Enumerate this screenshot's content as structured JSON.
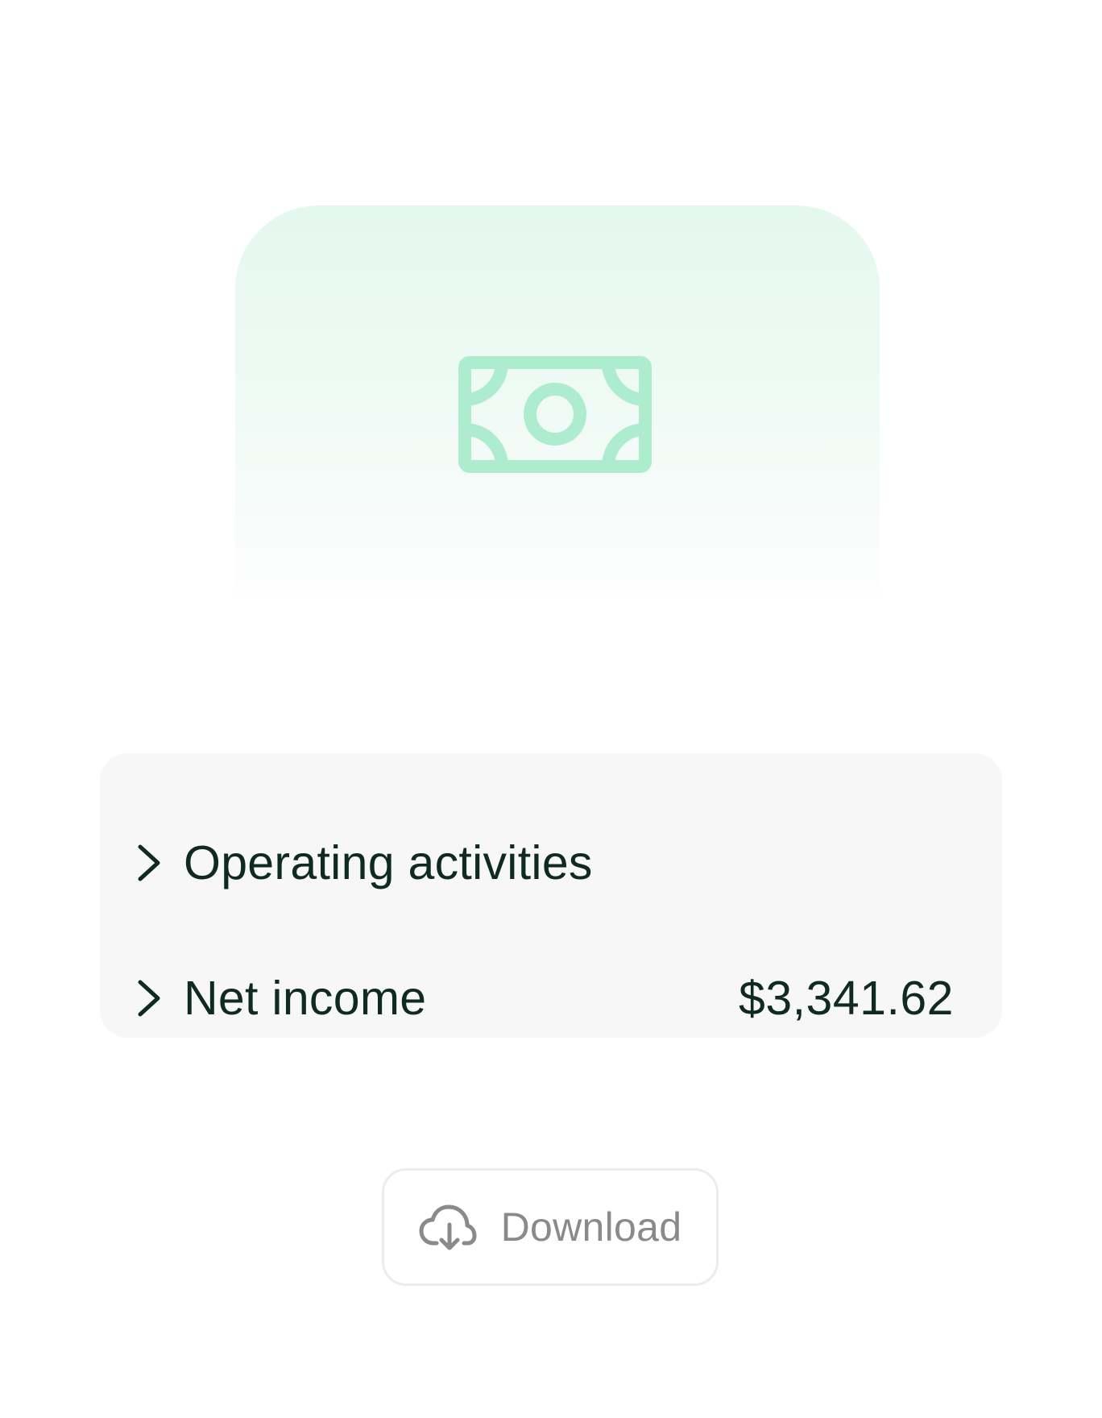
{
  "hero": {
    "icon": "banknote-icon",
    "accent_color": "#aeeccf",
    "background_color": "#e4f8ef"
  },
  "cash_flow": {
    "rows": [
      {
        "label": "Operating activities",
        "value": "",
        "icon": "chevron-right-icon"
      },
      {
        "label": "Net income",
        "value": "$3,341.62",
        "icon": "chevron-right-icon"
      }
    ],
    "text_color": "#0f2a22",
    "card_color": "#f7f7f7"
  },
  "download": {
    "label": "Download",
    "icon": "cloud-download-icon",
    "text_color": "#8a8a8a"
  }
}
